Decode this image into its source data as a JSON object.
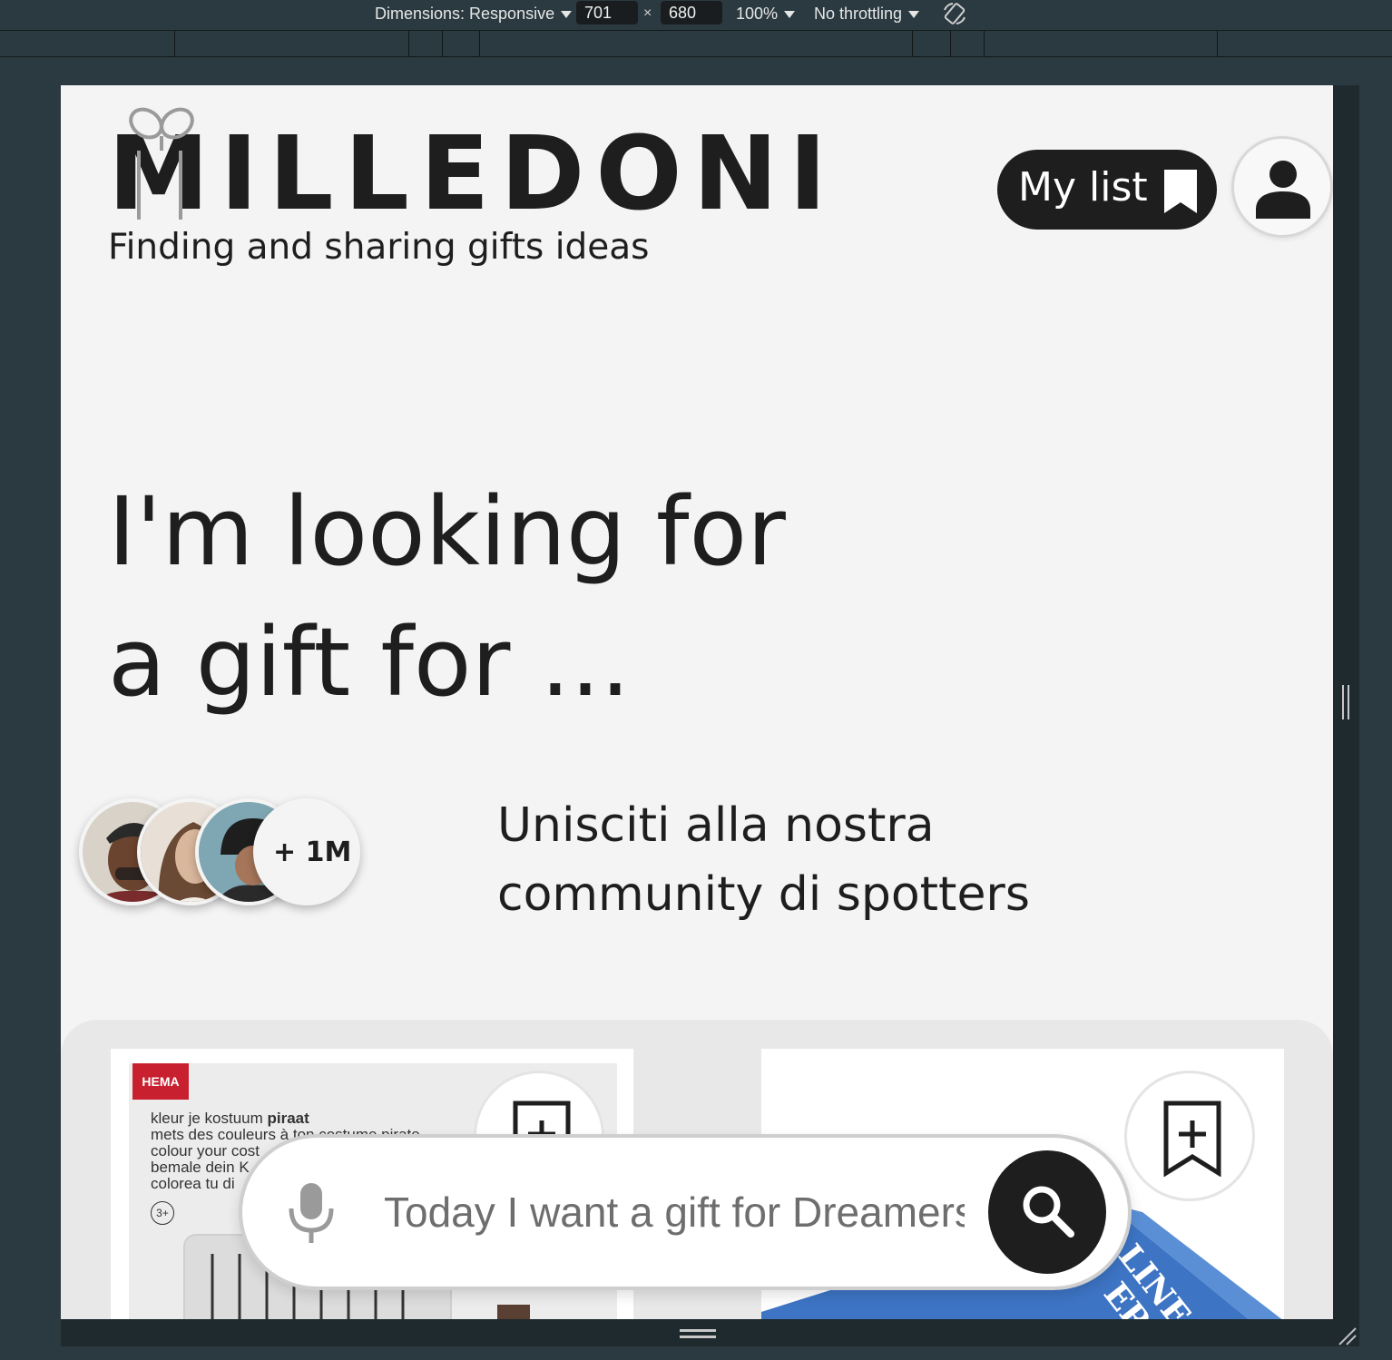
{
  "devtools": {
    "dimensions_label": "Dimensions: Responsive",
    "width_value": "701",
    "times": "×",
    "height_value": "680",
    "zoom_label": "100%",
    "throttling_label": "No throttling"
  },
  "header": {
    "logo_text": "MILLEDONI",
    "tagline": "Finding and sharing gifts ideas",
    "my_list_label": "My list"
  },
  "hero": {
    "line1": "I'm looking for",
    "line2": "a gift for ..."
  },
  "community": {
    "count_badge": "+ 1M",
    "line1": "Unisciti alla nostra",
    "line2": "community di spotters"
  },
  "products": {
    "left": {
      "brand": "HEMA",
      "line1_plain": "kleur je kostuum ",
      "line1_bold": "piraat",
      "line2": "mets des couleurs à ton costume pirate",
      "line3": "colour your cost",
      "line4": "bemale dein K",
      "line5": "colorea tu di",
      "age": "3+"
    },
    "right": {
      "box_text_1": "LINE",
      "box_text_2": "ERDAG"
    }
  },
  "search": {
    "placeholder": "Today I want a gift for Dreamers"
  },
  "colors": {
    "ink": "#1e1e1e",
    "page_bg": "#f4f4f4",
    "devtools_bg": "#2b3a40",
    "hema_red": "#c8202f",
    "box_blue": "#3d74c4"
  }
}
